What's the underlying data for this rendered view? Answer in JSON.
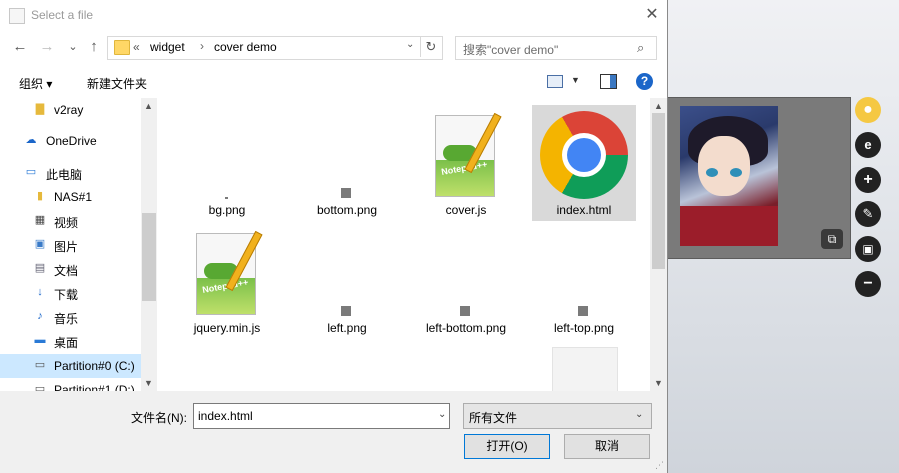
{
  "dialog": {
    "title": "Select a file",
    "nav": {
      "back": "←",
      "forward": "→",
      "recent": "⌄",
      "up": "↑"
    },
    "address": {
      "overflow": "«",
      "segments": [
        "widget",
        "cover demo"
      ],
      "separator": "›"
    },
    "search_placeholder": "搜索\"cover demo\"",
    "toolbar": {
      "organize": "组织 ▾",
      "new_folder": "新建文件夹"
    },
    "nav_pane": [
      {
        "label": "v2ray",
        "icon": "folder-check-icon"
      },
      {
        "label": "OneDrive",
        "icon": "cloud-icon"
      },
      {
        "label": "此电脑",
        "icon": "computer-icon"
      },
      {
        "label": "NAS#1",
        "icon": "network-drive-icon"
      },
      {
        "label": "视频",
        "icon": "video-icon"
      },
      {
        "label": "图片",
        "icon": "pictures-icon"
      },
      {
        "label": "文档",
        "icon": "documents-icon"
      },
      {
        "label": "下载",
        "icon": "download-icon"
      },
      {
        "label": "音乐",
        "icon": "music-icon"
      },
      {
        "label": "桌面",
        "icon": "desktop-icon"
      },
      {
        "label": "Partition#0 (C:)",
        "icon": "drive-icon",
        "selected": true
      },
      {
        "label": "Partition#1 (D:)",
        "icon": "drive-icon"
      }
    ],
    "files": [
      {
        "name": "bg.png",
        "kind": "tiny-image"
      },
      {
        "name": "bottom.png",
        "kind": "tiny-image"
      },
      {
        "name": "cover.js",
        "kind": "notepad"
      },
      {
        "name": "index.html",
        "kind": "chrome",
        "selected": true
      },
      {
        "name": "jquery.min.js",
        "kind": "notepad"
      },
      {
        "name": "left.png",
        "kind": "tiny-image"
      },
      {
        "name": "left-bottom.png",
        "kind": "tiny-image"
      },
      {
        "name": "left-top.png",
        "kind": "tiny-image"
      },
      {
        "name": "",
        "kind": "blank"
      }
    ],
    "filename_label": "文件名(N):",
    "filename_value": "index.html",
    "filter_value": "所有文件",
    "open_label": "打开(O)",
    "cancel_label": "取消"
  },
  "colors": {
    "selection": "#cce8ff",
    "accent": "#0078d7"
  }
}
